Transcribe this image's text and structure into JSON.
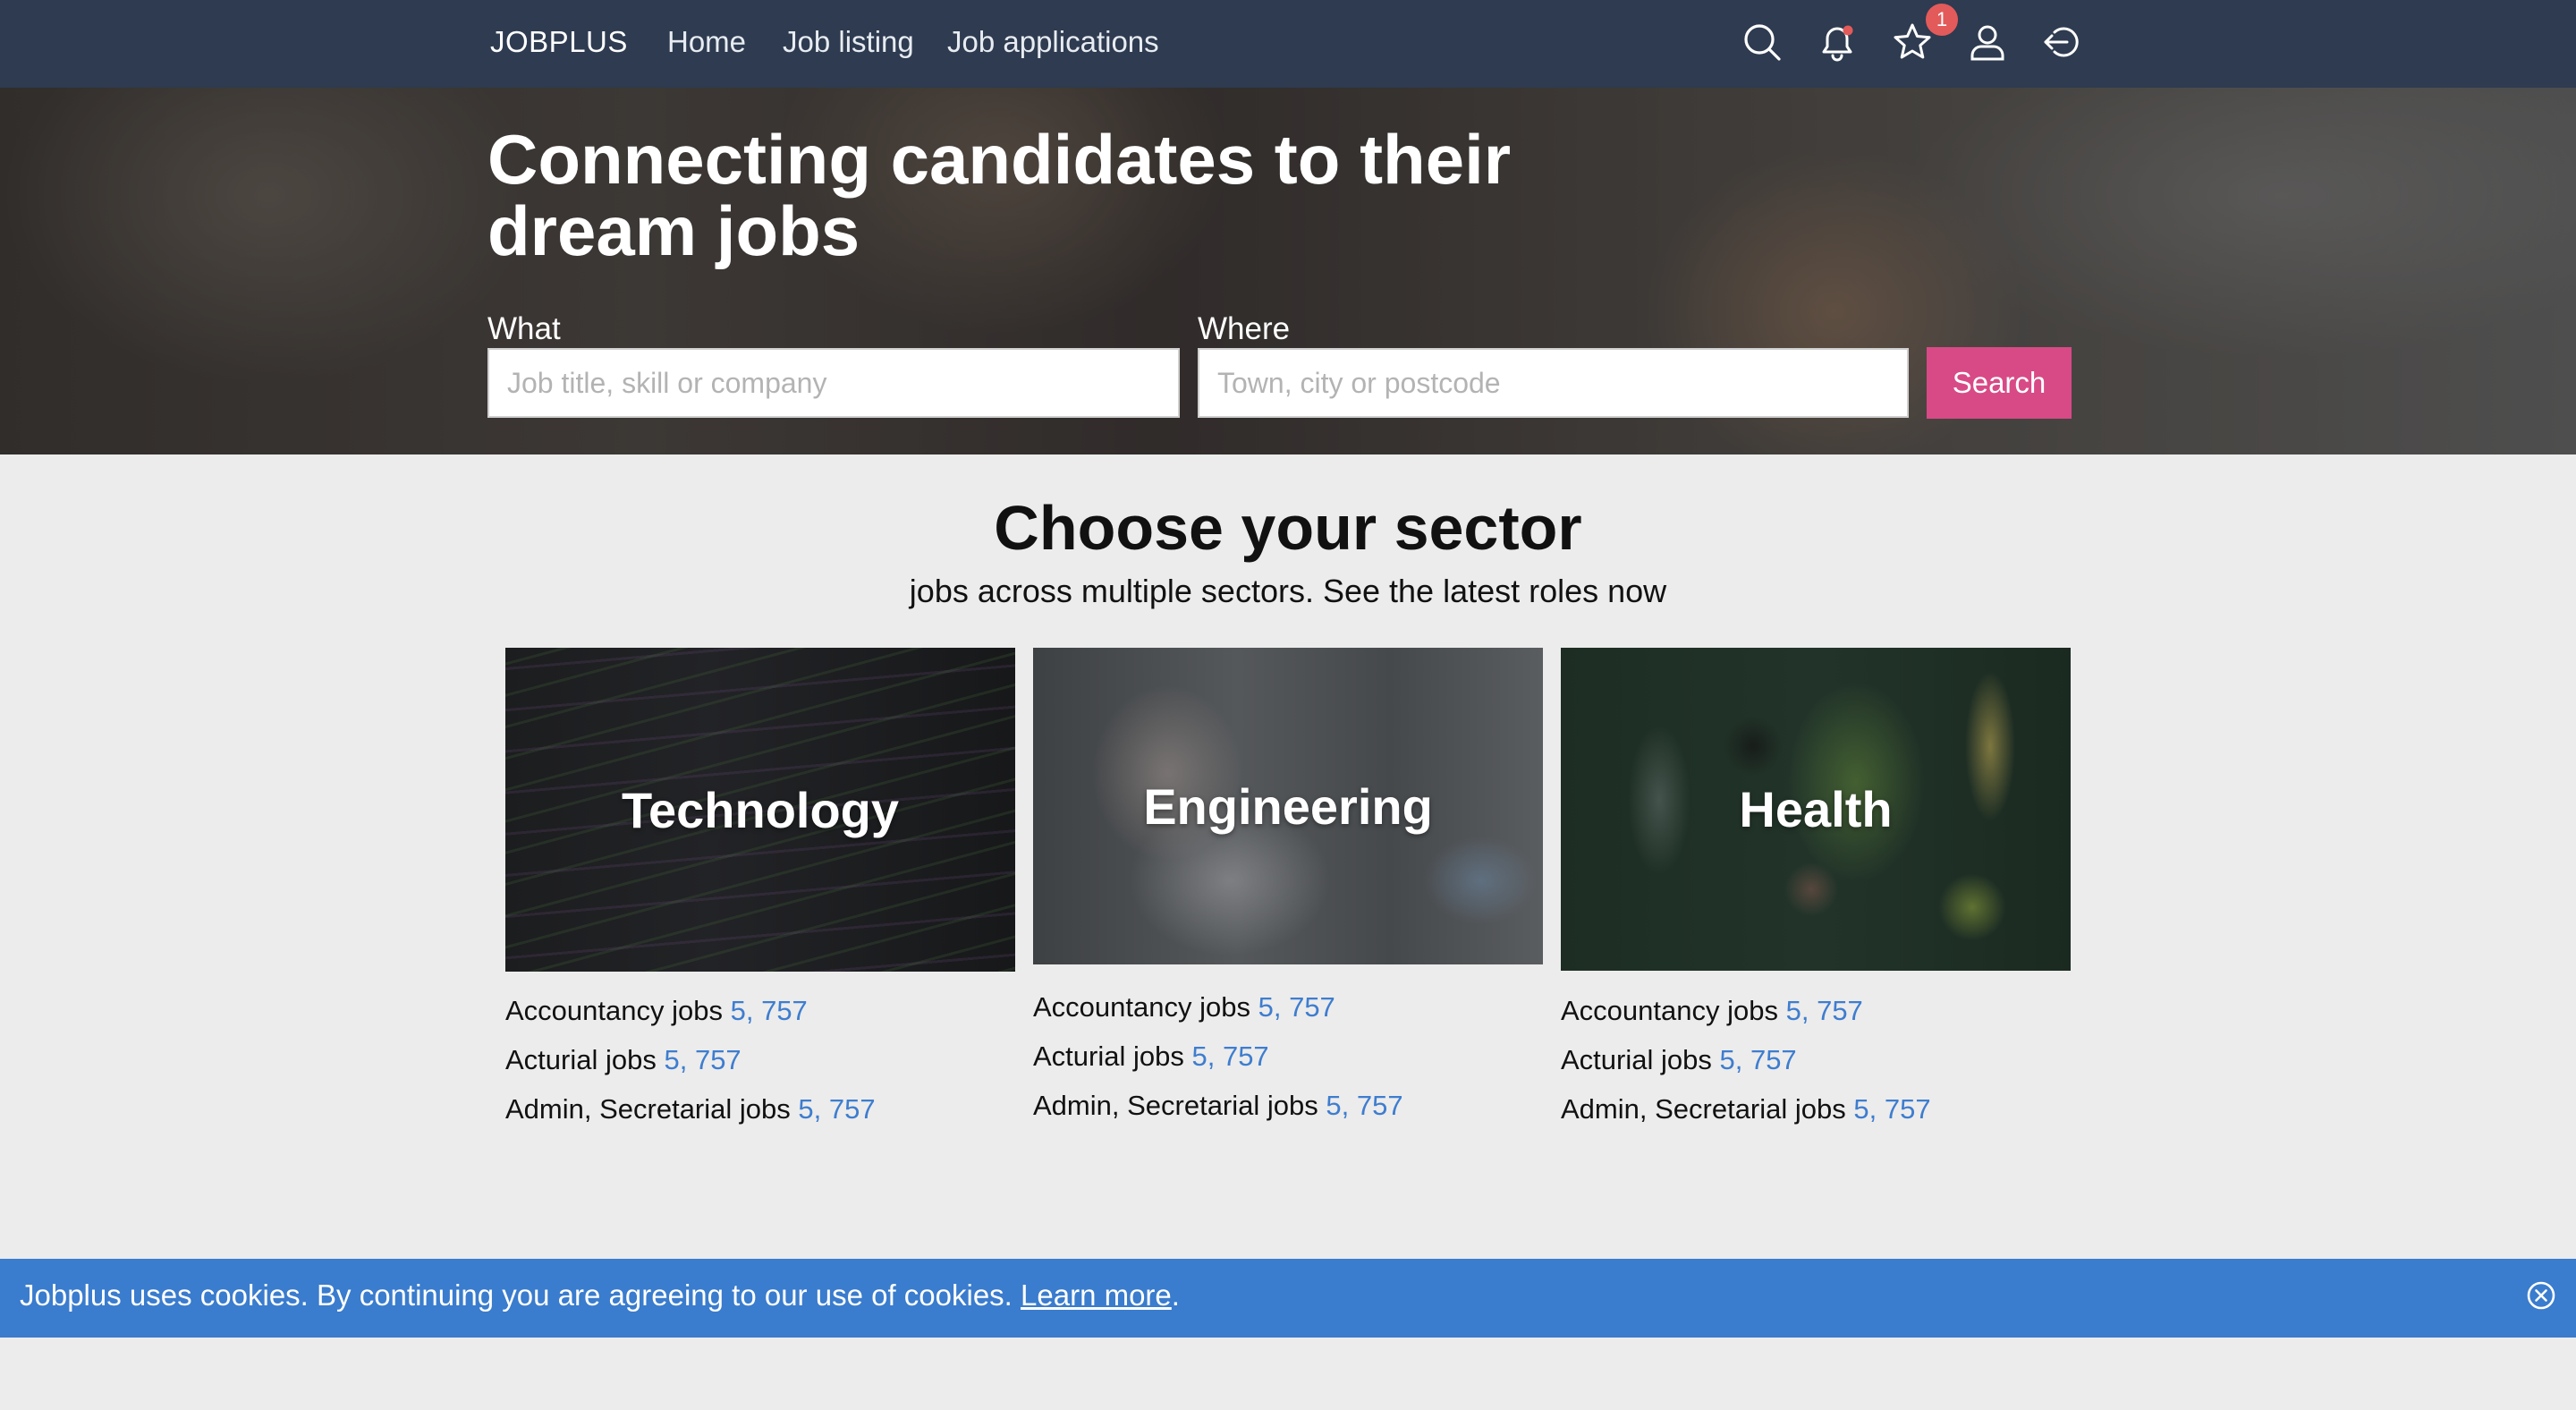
{
  "navbar": {
    "brand": "JOBPLUS",
    "links": [
      "Home",
      "Job listing",
      "Job applications"
    ],
    "icons": [
      "search-icon",
      "bell-icon",
      "star-icon",
      "user-icon",
      "logout-icon"
    ],
    "favorites_badge": "1",
    "notification_dot_color": "#e35a5a",
    "background_color": "#2e3b50"
  },
  "hero": {
    "title": "Connecting candidates to their dream jobs",
    "what_label": "What",
    "what_placeholder": "Job title, skill or company",
    "where_label": "Where",
    "where_placeholder": "Town, city or postcode",
    "search_button": "Search",
    "search_button_color": "#d84a86"
  },
  "sectors": {
    "title": "Choose your sector",
    "subtitle": "jobs across multiple sectors. See the latest roles now",
    "cards": [
      {
        "label": "Technology",
        "jobs": [
          {
            "name": "Accountancy jobs",
            "count": "5, 757"
          },
          {
            "name": "Acturial jobs",
            "count": "5, 757"
          },
          {
            "name": "Admin, Secretarial jobs",
            "count": "5, 757"
          }
        ]
      },
      {
        "label": "Engineering",
        "jobs": [
          {
            "name": "Accountancy jobs",
            "count": "5, 757"
          },
          {
            "name": "Acturial jobs",
            "count": "5, 757"
          },
          {
            "name": "Admin, Secretarial jobs",
            "count": "5, 757"
          }
        ]
      },
      {
        "label": "Health",
        "jobs": [
          {
            "name": "Accountancy jobs",
            "count": "5, 757"
          },
          {
            "name": "Acturial jobs",
            "count": "5, 757"
          },
          {
            "name": "Admin, Secretarial jobs",
            "count": "5, 757"
          }
        ]
      }
    ],
    "count_color": "#3e7dcf"
  },
  "cookie_bar": {
    "text": "Jobplus uses cookies. By continuing you are agreeing to our use of cookies.",
    "link": "Learn more",
    "suffix": ".",
    "close_icon": "close-circle-icon",
    "background_color": "#3a7ccd"
  }
}
